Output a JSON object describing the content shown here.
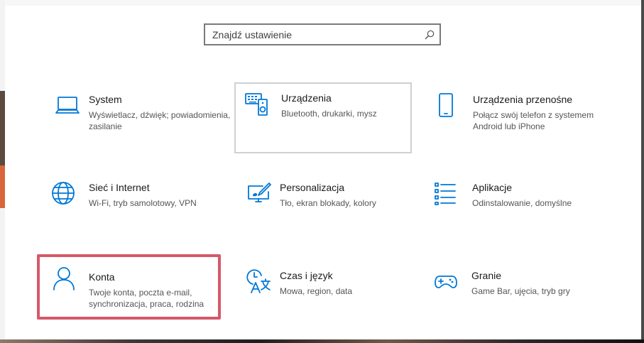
{
  "search": {
    "placeholder": "Znajdź ustawienie",
    "icon": "search-icon"
  },
  "tiles": [
    {
      "id": "system",
      "icon": "laptop-icon",
      "title": "System",
      "desc": "Wyświetlacz, dźwięk; powiadomienia, zasilanie"
    },
    {
      "id": "devices",
      "icon": "keyboard-speaker-icon",
      "title": "Urządzenia",
      "desc": "Bluetooth, drukarki, mysz"
    },
    {
      "id": "phone",
      "icon": "phone-icon",
      "title": "Urządzenia przenośne",
      "desc": "Połącz swój telefon z systemem Android lub iPhone"
    },
    {
      "id": "network",
      "icon": "globe-icon",
      "title": "Sieć i Internet",
      "desc": "Wi-Fi, tryb samolotowy, VPN"
    },
    {
      "id": "personalization",
      "icon": "paint-screen-icon",
      "title": "Personalizacja",
      "desc": "Tło, ekran blokady, kolory"
    },
    {
      "id": "apps",
      "icon": "apps-list-icon",
      "title": "Aplikacje",
      "desc": "Odinstalowanie, domyślne"
    },
    {
      "id": "accounts",
      "icon": "person-icon",
      "title": "Konta",
      "desc": "Twoje konta, poczta e-mail, synchronizacja, praca, rodzina"
    },
    {
      "id": "time",
      "icon": "time-language-icon",
      "title": "Czas i język",
      "desc": "Mowa, region, data"
    },
    {
      "id": "gaming",
      "icon": "gamepad-icon",
      "title": "Granie",
      "desc": "Game Bar, ujęcia, tryb gry"
    }
  ],
  "colors": {
    "accent": "#0078d7",
    "highlight": "#d6586a"
  }
}
